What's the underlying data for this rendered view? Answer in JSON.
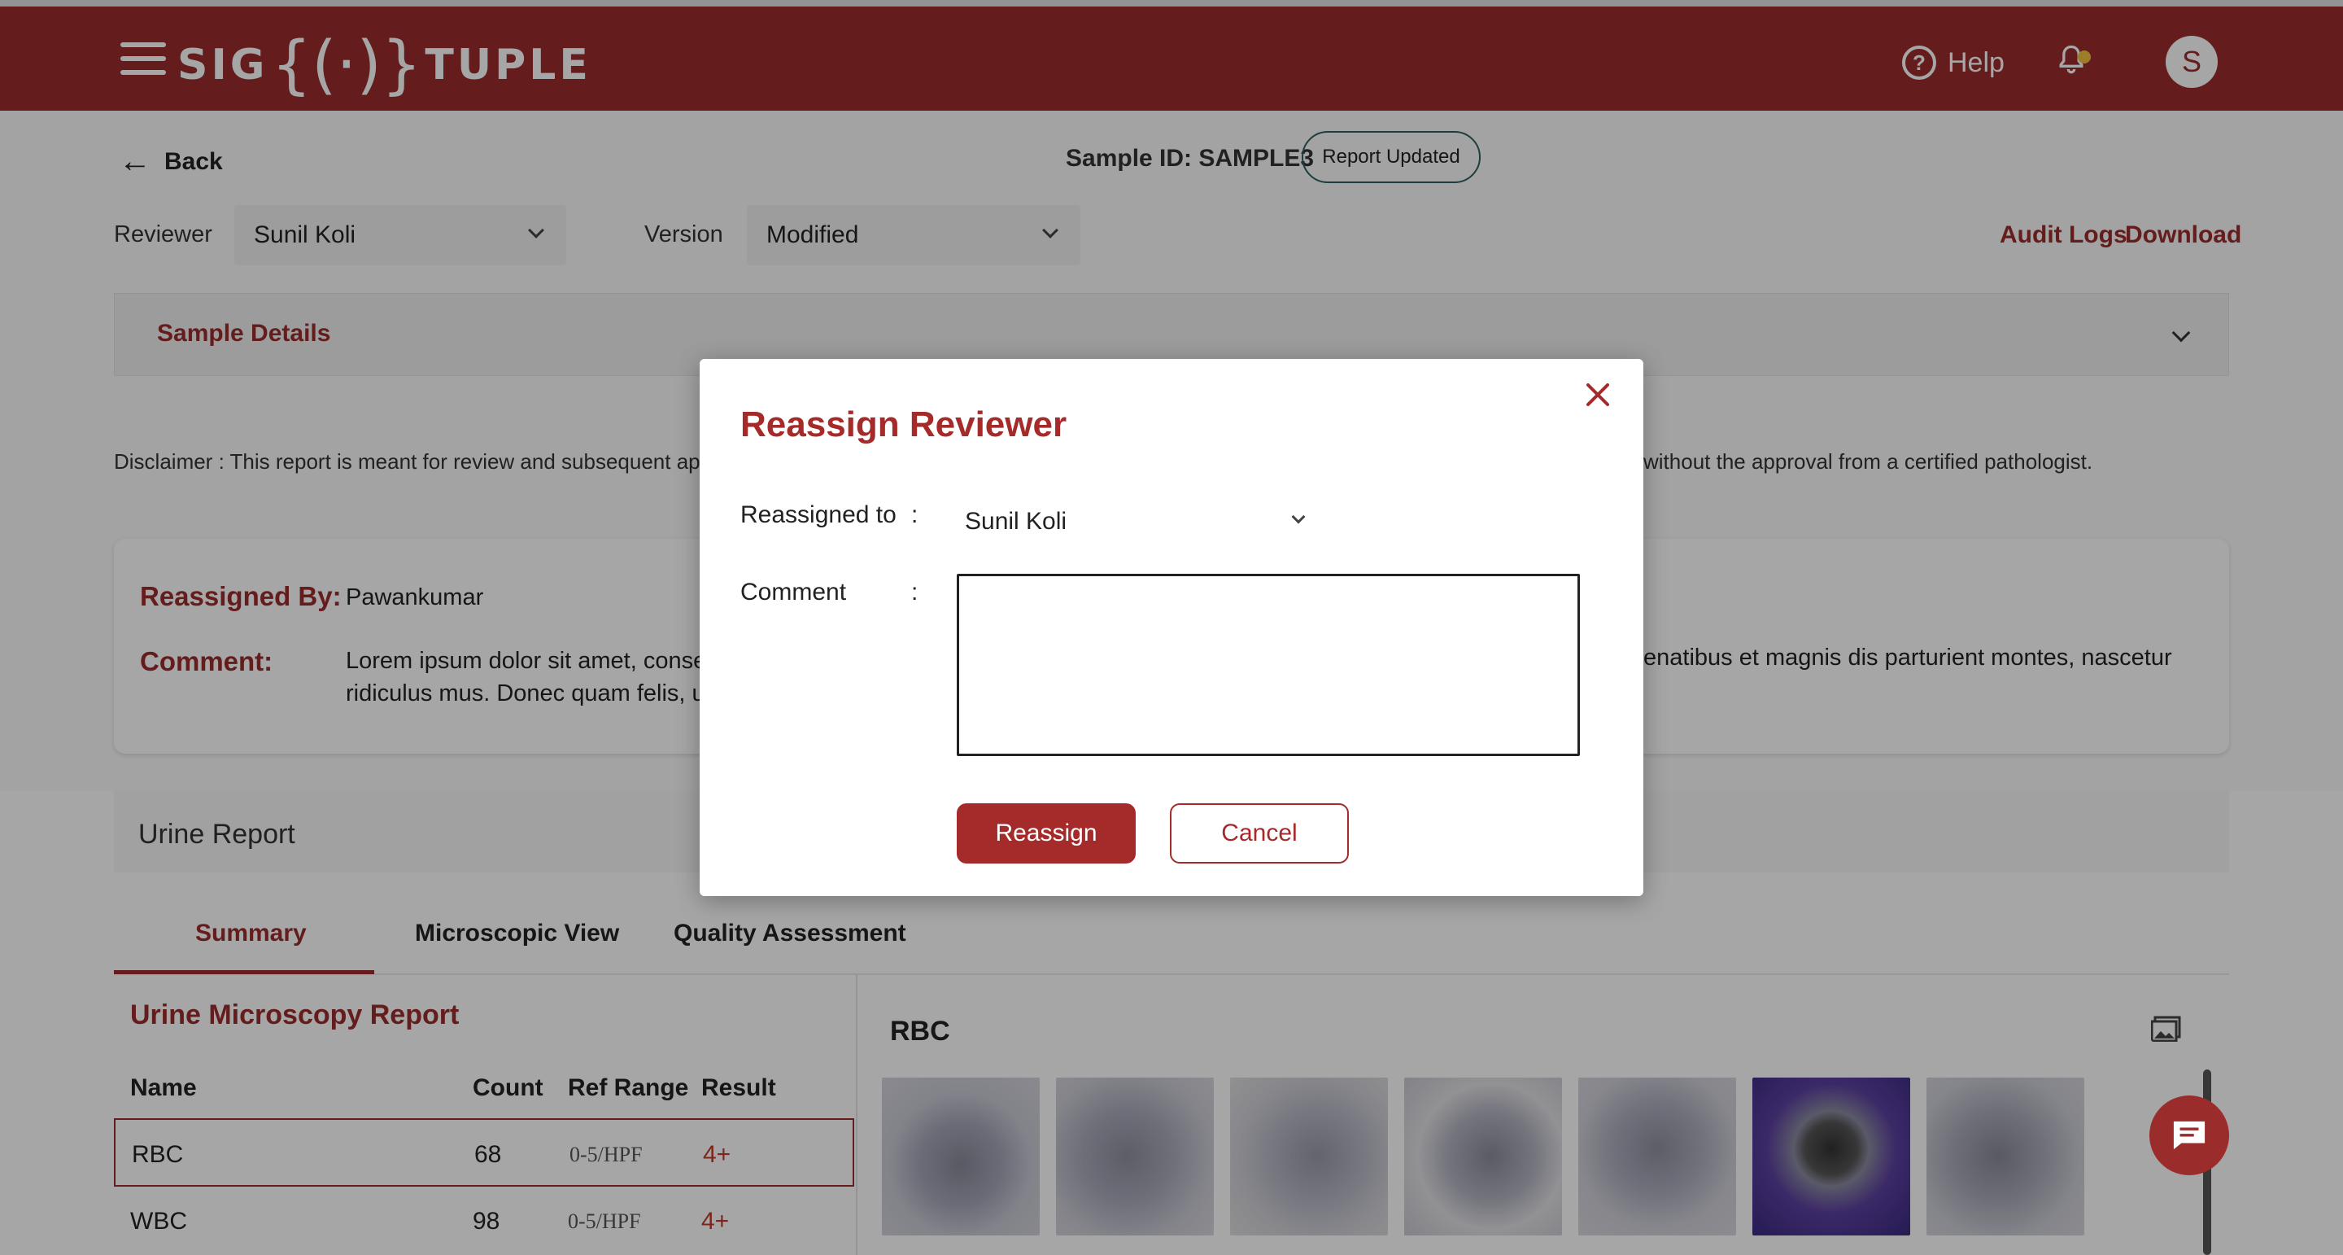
{
  "header": {
    "logo_left": "SIG",
    "logo_mark": "{(·)}",
    "logo_right": "TUPLE",
    "help_label": "Help",
    "avatar_initial": "S"
  },
  "page": {
    "back_label": "Back",
    "sample_id": "Sample ID: SAMPLE3",
    "status_badge": "Report Updated",
    "reviewer_label": "Reviewer",
    "reviewer_value": "Sunil Koli",
    "version_label": "Version",
    "version_value": "Modified",
    "audit_logs": "Audit Logs",
    "download": "Download",
    "sample_details": "Sample Details",
    "disclaimer": "Disclaimer :  This report is meant for review and subsequent app",
    "disclaimer_tail": "without the approval from a certified pathologist."
  },
  "reassign_card": {
    "by_label": "Reassigned By:",
    "by_value": "Pawankumar",
    "comment_label": "Comment:",
    "comment_text": "Lorem ipsum dolor sit amet, consect ridiculus mus. Donec quam felis, ult",
    "comment_tail": "enatibus et magnis dis parturient montes, nascetur"
  },
  "report": {
    "title": "Urine Report",
    "tabs": [
      {
        "label": "Summary",
        "active": true
      },
      {
        "label": "Microscopic View",
        "active": false
      },
      {
        "label": "Quality Assessment",
        "active": false
      }
    ],
    "table_title": "Urine Microscopy Report",
    "columns": [
      "Name",
      "Count",
      "Ref Range",
      "Result"
    ],
    "rows": [
      {
        "name": "RBC",
        "count": "68",
        "ref": "0-5/HPF",
        "result": "4+"
      },
      {
        "name": "WBC",
        "count": "98",
        "ref": "0-5/HPF",
        "result": "4+"
      }
    ],
    "gallery_title": "RBC",
    "thumb_count": 7
  },
  "modal": {
    "title": "Reassign Reviewer",
    "reassigned_to_label": "Reassigned to",
    "colon": ":",
    "reassigned_to_value": "Sunil Koli",
    "comment_label": "Comment",
    "comment_value": "",
    "reassign_button": "Reassign",
    "cancel_button": "Cancel"
  },
  "colors": {
    "brand": "#9b2c2c",
    "accent": "#a52a2a",
    "notification_dot": "#f0c040"
  },
  "icons": [
    "hamburger-icon",
    "help-icon",
    "bell-icon",
    "back-arrow-icon",
    "chevron-down-icon",
    "close-icon",
    "gallery-icon",
    "chat-icon"
  ]
}
